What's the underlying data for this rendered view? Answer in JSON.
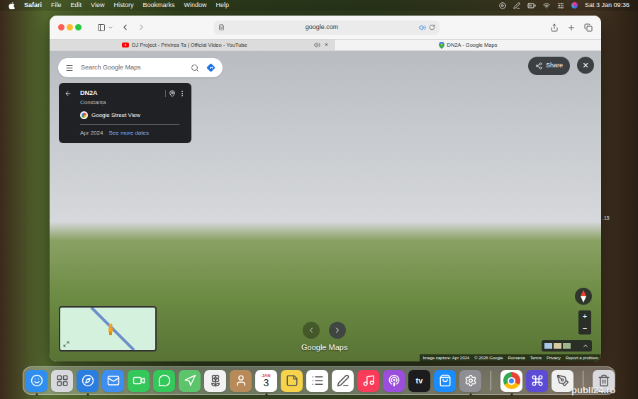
{
  "menu_bar": {
    "app": "Safari",
    "menus": [
      "File",
      "Edit",
      "View",
      "History",
      "Bookmarks",
      "Window",
      "Help"
    ],
    "clock": "Sat 3 Jan 09:36"
  },
  "browser": {
    "address": "google.com",
    "address_audio": true,
    "close_button": "×",
    "tabs": [
      {
        "label": "DJ Project - Privirea Ta | Official Video - YouTube",
        "selected": false,
        "audio": true,
        "closable": true
      },
      {
        "label": "DN2A - Google Maps",
        "selected": true,
        "audio": false,
        "closable": false
      }
    ]
  },
  "maps": {
    "search": {
      "placeholder": "Search Google Maps"
    },
    "place_card": {
      "title": "DN2A",
      "subtitle": "Constanța",
      "source": "Google Street View",
      "date": "Apr 2024",
      "more_dates": "See more dates"
    },
    "share_button": "Share",
    "close_button": "×",
    "zoom": [
      "+",
      "−"
    ],
    "brand": "Google Maps",
    "footer": [
      "Image capture: Apr 2024",
      "© 2026 Google",
      "Romania",
      "Terms",
      "Privacy",
      "Report a problem"
    ]
  },
  "desktop_fragment": ".15",
  "dock": {
    "items": [
      {
        "kind": "finder",
        "color": "#2f8ff0",
        "running": true,
        "section": 1
      },
      {
        "kind": "launchpad",
        "color": "#d7d9de",
        "running": false,
        "section": 1
      },
      {
        "kind": "safari",
        "color": "#2a7de1",
        "running": true,
        "section": 1
      },
      {
        "kind": "mail",
        "color": "#3d8ef0",
        "running": false,
        "section": 1
      },
      {
        "kind": "facetime",
        "color": "#34c759",
        "running": false,
        "section": 1
      },
      {
        "kind": "messages",
        "color": "#34c759",
        "running": false,
        "section": 1
      },
      {
        "kind": "maps",
        "color": "#5cc46a",
        "running": false,
        "section": 1
      },
      {
        "kind": "photos",
        "color": "#f2f2f2",
        "running": false,
        "section": 1
      },
      {
        "kind": "contacts",
        "color": "#b88a5a",
        "running": false,
        "section": 1
      },
      {
        "kind": "calendar",
        "color": "#ffffff",
        "running": true,
        "section": 1,
        "month": "JAN",
        "day": "3"
      },
      {
        "kind": "notes",
        "color": "#f6d34a",
        "running": false,
        "section": 1
      },
      {
        "kind": "reminders",
        "color": "#ffffff",
        "running": false,
        "section": 1
      },
      {
        "kind": "freeform",
        "color": "#ffffff",
        "running": false,
        "section": 1
      },
      {
        "kind": "music",
        "color": "#fa3c5a",
        "running": false,
        "section": 1
      },
      {
        "kind": "podcasts",
        "color": "#9b4ddb",
        "running": false,
        "section": 1
      },
      {
        "kind": "tv",
        "color": "#1c1c1e",
        "running": false,
        "section": 1,
        "label": "tv"
      },
      {
        "kind": "appstore",
        "color": "#1a8cff",
        "running": false,
        "section": 1
      },
      {
        "kind": "settings",
        "color": "#8e8e93",
        "running": true,
        "section": 1
      },
      {
        "kind": "chrome",
        "color": "#ffffff",
        "running": true,
        "section": 2
      },
      {
        "kind": "shortcuts",
        "color": "#5b4bd6",
        "running": false,
        "section": 2
      },
      {
        "kind": "script",
        "color": "#f0f0f0",
        "running": false,
        "section": 2
      },
      {
        "kind": "trash",
        "color": "#d9d9de",
        "running": false,
        "section": 3
      }
    ]
  },
  "watermark": "publi24.ro"
}
